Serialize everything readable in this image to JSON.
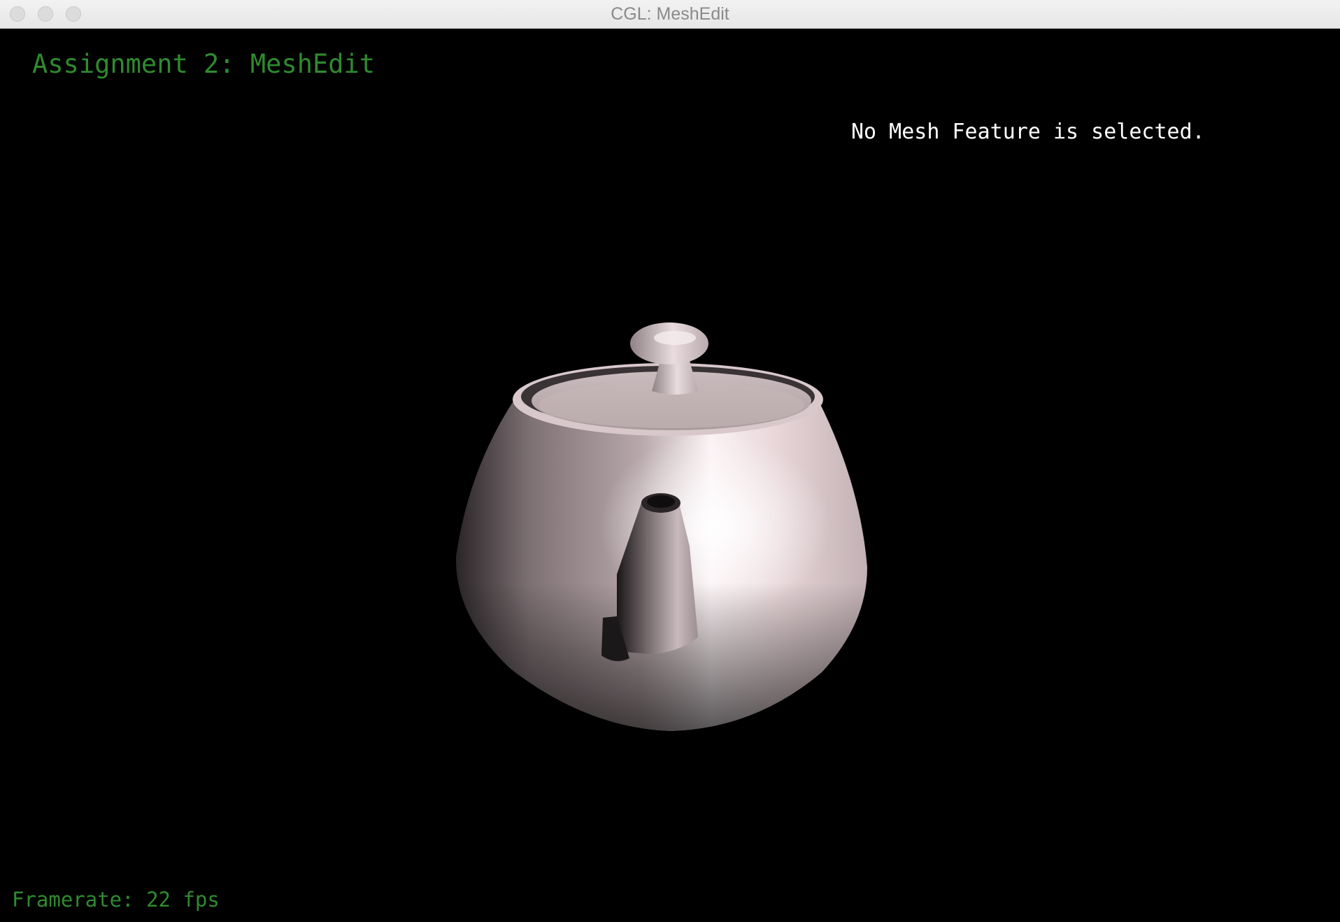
{
  "window": {
    "title": "CGL: MeshEdit"
  },
  "hud": {
    "assignment_title": "Assignment 2: MeshEdit",
    "selection_status": "No Mesh Feature is selected.",
    "framerate_label": "Framerate:",
    "framerate_value": "22",
    "framerate_unit": "fps"
  },
  "colors": {
    "background": "#000000",
    "hud_green": "#2f8a2f",
    "hud_white": "#ffffff",
    "mesh_base": "#d9c9cc"
  },
  "scene": {
    "model": "teapot-mesh"
  }
}
